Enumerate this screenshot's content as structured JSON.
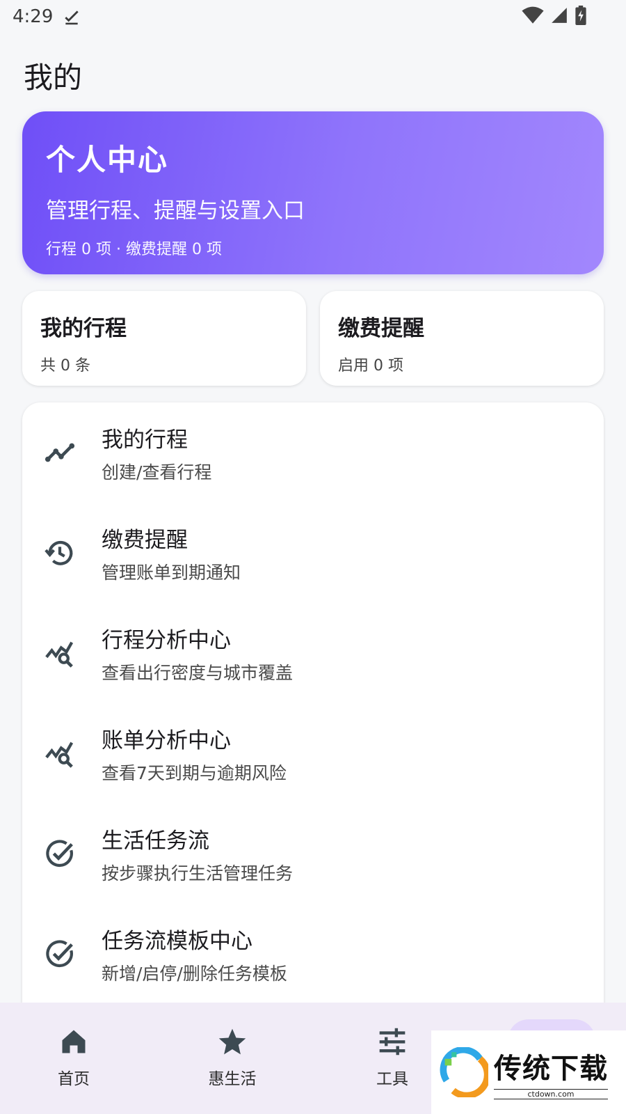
{
  "status_bar": {
    "time": "4:29"
  },
  "page": {
    "title": "我的"
  },
  "hero": {
    "title": "个人中心",
    "subtitle": "管理行程、提醒与设置入口",
    "stats": "行程 0 项 · 缴费提醒 0 项"
  },
  "mini_cards": [
    {
      "title": "我的行程",
      "subtitle": "共 0 条"
    },
    {
      "title": "缴费提醒",
      "subtitle": "启用 0 项"
    }
  ],
  "menu_items": [
    {
      "title": "我的行程",
      "subtitle": "创建/查看行程",
      "icon": "trend-line-icon"
    },
    {
      "title": "缴费提醒",
      "subtitle": "管理账单到期通知",
      "icon": "history-icon"
    },
    {
      "title": "行程分析中心",
      "subtitle": "查看出行密度与城市覆盖",
      "icon": "query-stats-icon"
    },
    {
      "title": "账单分析中心",
      "subtitle": "查看7天到期与逾期风险",
      "icon": "query-stats-icon"
    },
    {
      "title": "生活任务流",
      "subtitle": "按步骤执行生活管理任务",
      "icon": "check-circle-icon"
    },
    {
      "title": "任务流模板中心",
      "subtitle": "新增/启停/删除任务模板",
      "icon": "check-circle-icon"
    }
  ],
  "bottom_nav": [
    {
      "label": "首页",
      "icon": "home-icon"
    },
    {
      "label": "惠生活",
      "icon": "star-icon"
    },
    {
      "label": "工具",
      "icon": "tune-icon"
    }
  ],
  "watermark": {
    "name": "传统下载",
    "url": "ctdown.com"
  },
  "colors": {
    "accent": "#7b5cf9",
    "nav_bg": "#f1ecf7"
  }
}
